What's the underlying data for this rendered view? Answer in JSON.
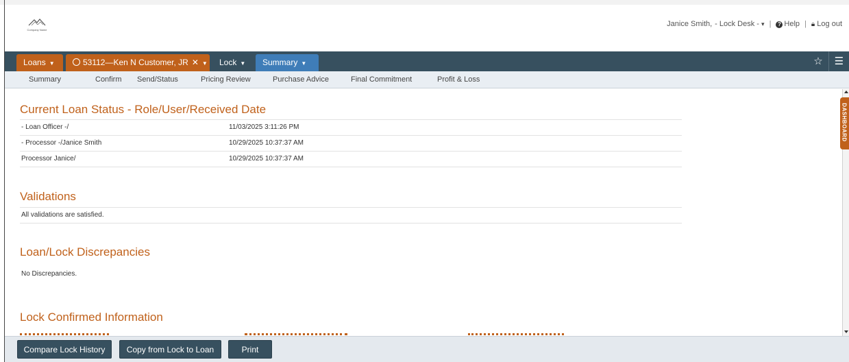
{
  "header": {
    "logo_text": "Company Name",
    "user_name": "Janice Smith,",
    "role_label": "- Lock Desk -",
    "help_label": "Help",
    "logout_label": "Log out"
  },
  "nav": {
    "loans_label": "Loans",
    "customer_tab_label": "53112—Ken N Customer, JR",
    "lock_label": "Lock",
    "summary_label": "Summary"
  },
  "subnav": {
    "items": [
      "Summary",
      "Confirm",
      "Send/Status",
      "Pricing Review",
      "Purchase Advice",
      "Final Commitment",
      "Profit & Loss"
    ]
  },
  "status_section": {
    "title": "Current Loan Status - Role/User/Received Date",
    "rows": [
      {
        "role": "- Loan Officer -/",
        "date": "11/03/2025 3:11:26 PM"
      },
      {
        "role": "- Processor -/Janice Smith",
        "date": "10/29/2025 10:37:37 AM"
      },
      {
        "role": "Processor Janice/",
        "date": "10/29/2025 10:37:37 AM"
      }
    ]
  },
  "validations": {
    "title": "Validations",
    "message": "All validations are satisfied."
  },
  "discrepancies": {
    "title": "Loan/Lock Discrepancies",
    "message": "No Discrepancies."
  },
  "lock_confirmed": {
    "title": "Lock Confirmed Information"
  },
  "dashboard_label": "DASHBOARD",
  "footer": {
    "compare_label": "Compare Lock History",
    "copy_label": "Copy from Lock to Loan",
    "print_label": "Print"
  },
  "colors": {
    "accent_orange": "#c0611b",
    "nav_dark": "#37505f",
    "nav_blue": "#3f7db8"
  }
}
